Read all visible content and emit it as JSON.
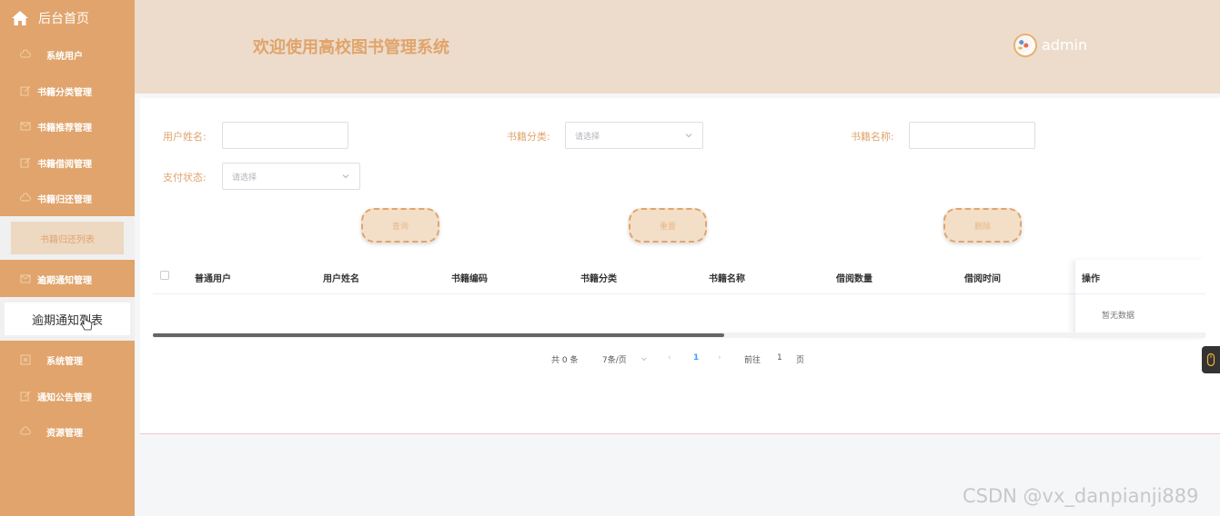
{
  "sidebar": {
    "home_label": "后台首页",
    "items": [
      {
        "label": "系统用户",
        "icon": "cloud-icon"
      },
      {
        "label": "书籍分类管理",
        "icon": "edit-icon"
      },
      {
        "label": "书籍推荐管理",
        "icon": "message-icon"
      },
      {
        "label": "书籍借阅管理",
        "icon": "edit-icon"
      },
      {
        "label": "书籍归还管理",
        "icon": "cloud-icon"
      },
      {
        "label": "逾期通知管理",
        "icon": "message-icon"
      },
      {
        "label": "系统管理",
        "icon": "box-icon"
      },
      {
        "label": "通知公告管理",
        "icon": "edit-icon"
      },
      {
        "label": "资源管理",
        "icon": "cloud-icon"
      }
    ],
    "sub_return_list": "书籍归还列表",
    "sub_overdue_list": "逾期通知列表"
  },
  "header": {
    "title": "欢迎使用高校图书管理系统",
    "username": "admin"
  },
  "search": {
    "user_name_label": "用户姓名:",
    "category_label": "书籍分类:",
    "book_name_label": "书籍名称:",
    "pay_status_label": "支付状态:",
    "select_placeholder": "请选择"
  },
  "buttons": {
    "query": "查询",
    "reset": "重置",
    "delete": "删除"
  },
  "table": {
    "columns": [
      "普通用户",
      "用户姓名",
      "书籍编码",
      "书籍分类",
      "书籍名称",
      "借阅数量",
      "借阅时间",
      "操作"
    ],
    "empty_text": "暂无数据"
  },
  "pagination": {
    "total": "共 0 条",
    "page_size": "7条/页",
    "current_page": "1",
    "goto_label": "前往",
    "goto_value": "1",
    "page_unit": "页"
  },
  "watermark": "CSDN @vx_danpianji889",
  "colors": {
    "sidebar": "#e0a46c",
    "header": "#eddccb",
    "accent": "#e0a46c",
    "pagination_active": "#409eff"
  }
}
